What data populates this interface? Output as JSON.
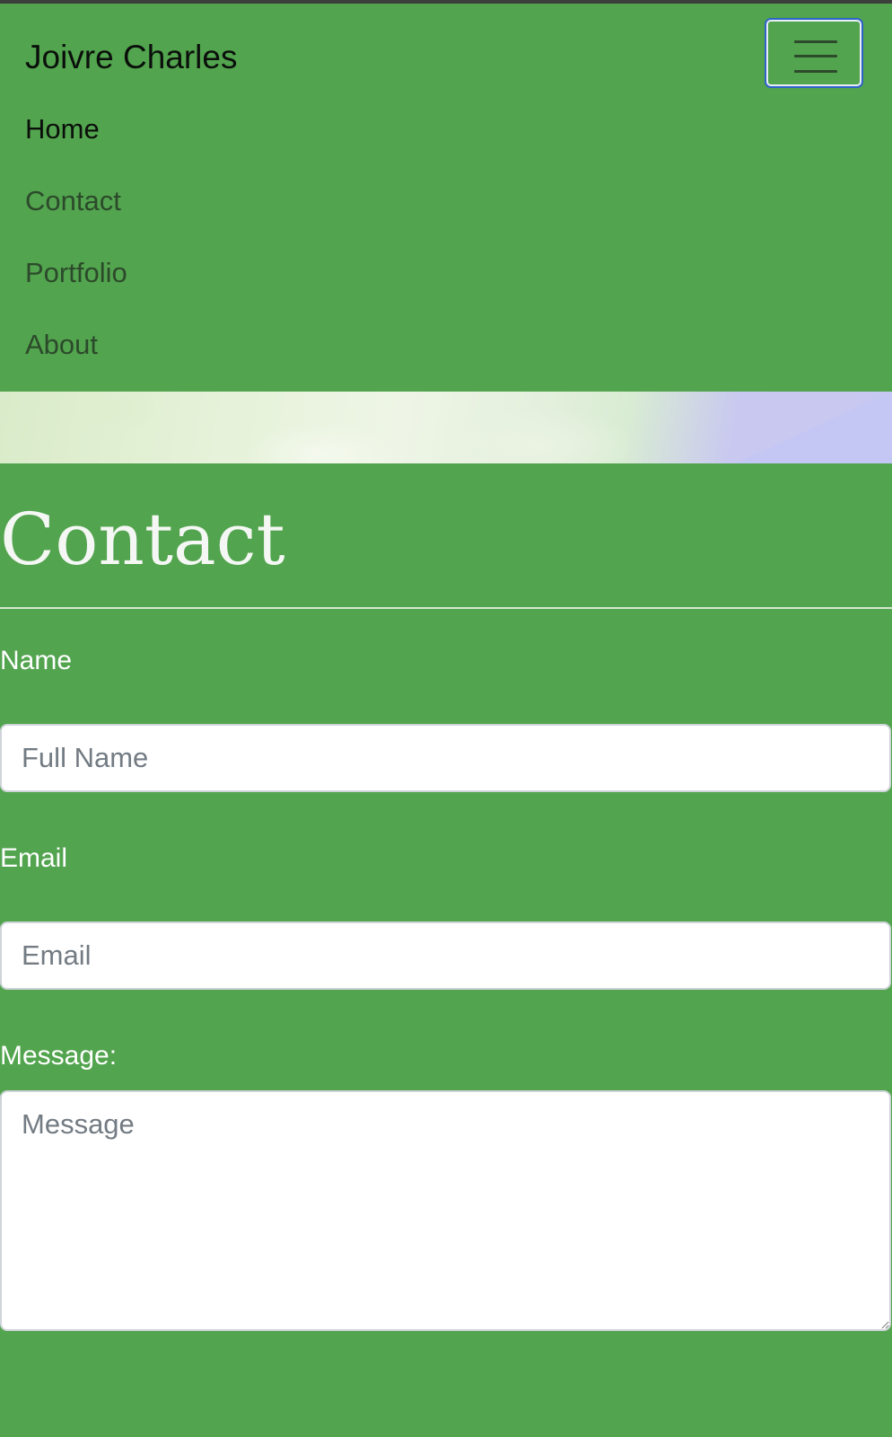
{
  "navbar": {
    "brand": "Joivre Charles",
    "toggler_icon": "hamburger-menu-icon",
    "items": [
      {
        "label": "Home",
        "active": true
      },
      {
        "label": "Contact",
        "active": false
      },
      {
        "label": "Portfolio",
        "active": false
      },
      {
        "label": "About",
        "active": false
      }
    ]
  },
  "page": {
    "title": "Contact"
  },
  "form": {
    "name": {
      "label": "Name",
      "placeholder": "Full Name",
      "value": ""
    },
    "email": {
      "label": "Email",
      "placeholder": "Email",
      "value": ""
    },
    "message": {
      "label": "Message:",
      "placeholder": "Message",
      "value": ""
    }
  },
  "colors": {
    "background": "#52a44e",
    "toggler_focus_ring": "#2f63c8",
    "title_text": "#f4f7f3",
    "nav_text": "#2c4a2b",
    "nav_text_active": "#0b0f0b"
  }
}
